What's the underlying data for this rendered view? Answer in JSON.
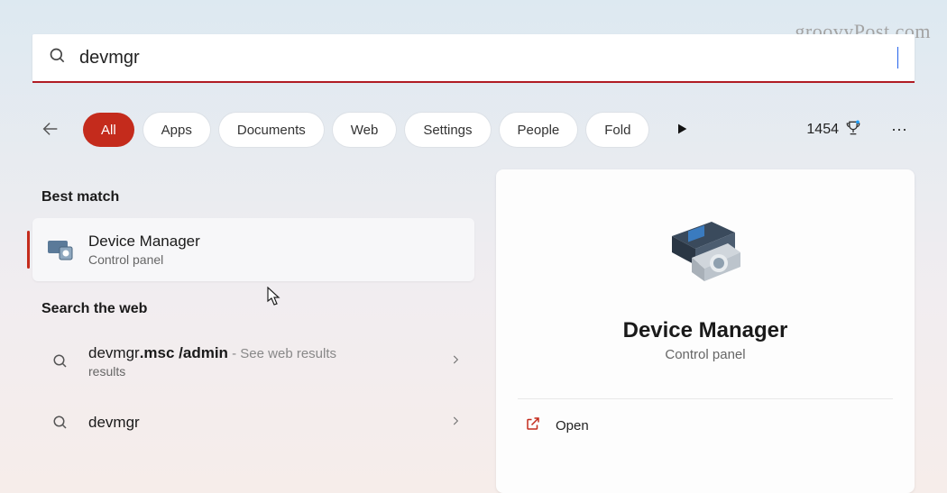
{
  "watermark": "groovyPost.com",
  "search": {
    "query": "devmgr",
    "placeholder": ""
  },
  "filters": {
    "items": [
      "All",
      "Apps",
      "Documents",
      "Web",
      "Settings",
      "People",
      "Fold"
    ],
    "active_index": 0
  },
  "rewards": {
    "points": "1454"
  },
  "sections": {
    "best_match": "Best match",
    "search_web": "Search the web"
  },
  "best_result": {
    "title": "Device Manager",
    "subtitle": "Control panel",
    "icon": "device-manager-icon"
  },
  "web_results": [
    {
      "prefix_bold": "devmgr",
      "suffix_bold": ".msc /admin",
      "tail": " - See web results"
    },
    {
      "prefix_bold": "devmgr",
      "suffix_bold": "",
      "tail": ""
    }
  ],
  "detail": {
    "title": "Device Manager",
    "subtitle": "Control panel",
    "open_label": "Open"
  }
}
